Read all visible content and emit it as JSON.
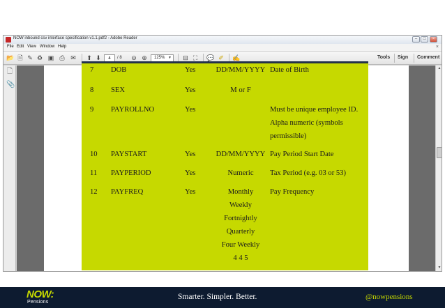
{
  "window": {
    "title": "NOW inbound csv interface specification v1.1.pdf2 - Adobe Reader",
    "controls": {
      "minimize": "–",
      "maximize": "□",
      "close": "×"
    }
  },
  "menu": {
    "items": [
      "File",
      "Edit",
      "View",
      "Window",
      "Help"
    ],
    "close_doc": "×"
  },
  "toolbar": {
    "page_current": "4",
    "page_total": "/ 8",
    "zoom": "125%",
    "right": [
      "Tools",
      "Sign",
      "Comment"
    ],
    "icons": [
      "open-icon",
      "create-pdf-icon",
      "edit-icon",
      "share-icon",
      "save-icon",
      "print-icon",
      "email-icon",
      "previous-page-icon",
      "next-page-icon",
      "zoom-out-icon",
      "zoom-in-icon",
      "zoom-dropdown-icon",
      "fit-page-icon",
      "full-screen-icon",
      "comment-icon",
      "highlight-icon",
      "sign-icon"
    ]
  },
  "table": {
    "rows": [
      {
        "num": "7",
        "name": "DOB",
        "required": "Yes",
        "format": [
          "DD/MM/YYYY"
        ],
        "description": [
          "Date of Birth"
        ]
      },
      {
        "num": "8",
        "name": "SEX",
        "required": "Yes",
        "format": [
          "M or F"
        ],
        "description": []
      },
      {
        "num": "9",
        "name": "PAYROLLNO",
        "required": "Yes",
        "format": [],
        "description": [
          "Must be unique employee ID.",
          "Alpha numeric (symbols",
          "permissible)"
        ]
      },
      {
        "num": "10",
        "name": "PAYSTART",
        "required": "Yes",
        "format": [
          "DD/MM/YYYY"
        ],
        "description": [
          "Pay Period Start Date"
        ]
      },
      {
        "num": "11",
        "name": "PAYPERIOD",
        "required": "Yes",
        "format": [
          "Numeric"
        ],
        "description": [
          "Tax Period (e.g. 03 or 53)"
        ]
      },
      {
        "num": "12",
        "name": "PAYFREQ",
        "required": "Yes",
        "format": [
          "Monthly",
          "Weekly",
          "Fortnightly",
          "Quarterly",
          "Four Weekly",
          "4 4 5"
        ],
        "description": [
          "Pay Frequency"
        ]
      }
    ]
  },
  "footer": {
    "logo_text": "NOW:",
    "logo_sub": "Pensions",
    "tagline": "Smarter. Simpler. Better.",
    "handle": "@nowpensions"
  },
  "colors": {
    "panel": "#c6d900",
    "footer": "#0d1b30",
    "accent": "#c6d900"
  }
}
